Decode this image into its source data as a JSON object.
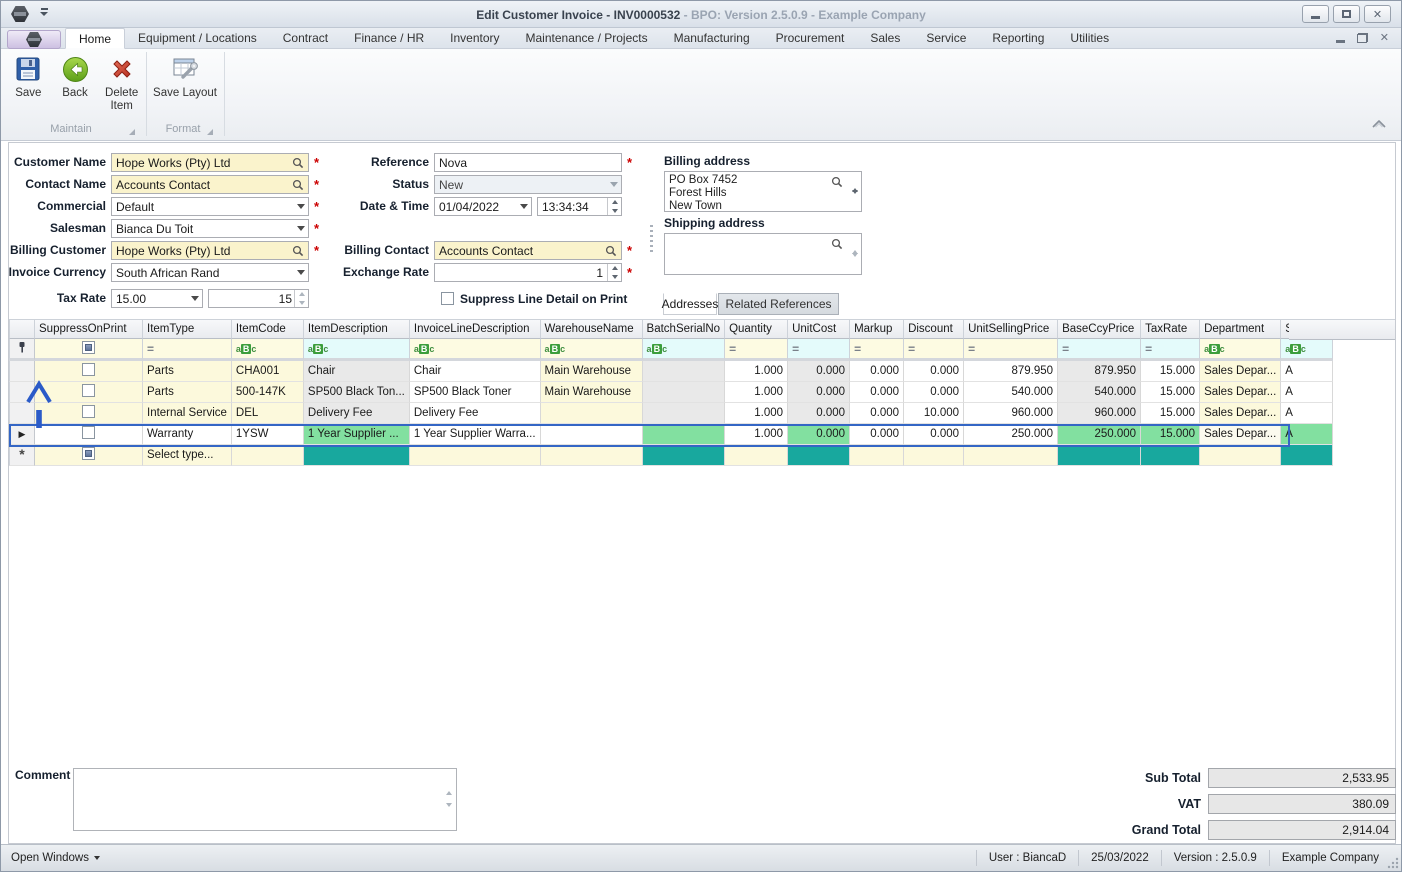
{
  "window": {
    "title": "Edit Customer Invoice - INV0000532",
    "title_suffix": " - BPO: Version 2.5.0.9 - Example Company"
  },
  "ribbon": {
    "tabs": [
      "Home",
      "Equipment / Locations",
      "Contract",
      "Finance / HR",
      "Inventory",
      "Maintenance / Projects",
      "Manufacturing",
      "Procurement",
      "Sales",
      "Service",
      "Reporting",
      "Utilities"
    ],
    "active_tab": "Home",
    "buttons": {
      "save": "Save",
      "back": "Back",
      "delete_item": "Delete\nItem",
      "save_layout": "Save Layout"
    },
    "groups": {
      "maintain": "Maintain",
      "format": "Format"
    }
  },
  "form": {
    "customer_name": {
      "label": "Customer Name",
      "value": "Hope Works (Pty) Ltd"
    },
    "contact_name": {
      "label": "Contact Name",
      "value": "Accounts Contact"
    },
    "commercial": {
      "label": "Commercial",
      "value": "Default"
    },
    "salesman": {
      "label": "Salesman",
      "value": "Bianca Du Toit"
    },
    "billing_customer": {
      "label": "Billing Customer",
      "value": "Hope Works (Pty) Ltd"
    },
    "invoice_currency": {
      "label": "Invoice Currency",
      "value": "South African Rand"
    },
    "tax_rate": {
      "label": "Tax Rate",
      "value": "15.00",
      "amount": "15"
    },
    "reference": {
      "label": "Reference",
      "value": "Nova"
    },
    "status": {
      "label": "Status",
      "value": "New"
    },
    "date_time": {
      "label": "Date & Time",
      "date": "01/04/2022",
      "time": "13:34:34"
    },
    "billing_contact": {
      "label": "Billing Contact",
      "value": "Accounts Contact"
    },
    "exchange_rate": {
      "label": "Exchange Rate",
      "value": "1"
    },
    "suppress_line_detail": {
      "label": "Suppress Line Detail on Print",
      "checked": false
    }
  },
  "addresses": {
    "billing_label": "Billing address",
    "billing_lines": [
      "PO Box 7452",
      "Forest Hills",
      "New Town"
    ],
    "shipping_label": "Shipping address",
    "shipping_lines": [],
    "tabs": [
      "Addresses",
      "Related References"
    ],
    "active_tab": "Addresses"
  },
  "grid": {
    "columns": [
      "SuppressOnPrint",
      "ItemType",
      "ItemCode",
      "ItemDescription",
      "InvoiceLineDescription",
      "WarehouseName",
      "BatchSerialNo",
      "Quantity",
      "UnitCost",
      "Markup",
      "Discount",
      "UnitSellingPrice",
      "BaseCcyPrice",
      "TaxRate",
      "Department",
      "Status"
    ],
    "filter_types": [
      "checkbox",
      "equals",
      "text",
      "text",
      "text",
      "text",
      "text",
      "equals",
      "equals",
      "equals",
      "equals",
      "equals",
      "equals",
      "equals",
      "text",
      "text"
    ],
    "rows": [
      {
        "suppress_on_print": false,
        "type": "Parts",
        "code": "CHA001",
        "desc": "Chair",
        "line_desc": "Chair",
        "warehouse": "Main Warehouse",
        "batch": "",
        "qty": "1.000",
        "unit_cost": "0.000",
        "markup": "0.000",
        "discount": "0.000",
        "unit_selling": "879.950",
        "base_ccy": "879.950",
        "tax": "15.000",
        "dept": "Sales Depar...",
        "status": "A"
      },
      {
        "suppress_on_print": false,
        "type": "Parts",
        "code": "500-147K",
        "desc": "SP500 Black Ton...",
        "line_desc": "SP500 Black Toner",
        "warehouse": "Main Warehouse",
        "batch": "",
        "qty": "1.000",
        "unit_cost": "0.000",
        "markup": "0.000",
        "discount": "0.000",
        "unit_selling": "540.000",
        "base_ccy": "540.000",
        "tax": "15.000",
        "dept": "Sales Depar...",
        "status": "A"
      },
      {
        "suppress_on_print": false,
        "type": "Internal Service",
        "code": "DEL",
        "desc": "Delivery Fee",
        "line_desc": "Delivery Fee",
        "warehouse": "",
        "batch": "",
        "qty": "1.000",
        "unit_cost": "0.000",
        "markup": "0.000",
        "discount": "10.000",
        "unit_selling": "960.000",
        "base_ccy": "960.000",
        "tax": "15.000",
        "dept": "Sales Depar...",
        "status": "A"
      },
      {
        "suppress_on_print": false,
        "selected": true,
        "type": "Warranty",
        "code": "1YSW",
        "desc": "1 Year Supplier ...",
        "line_desc": "1 Year Supplier Warra...",
        "warehouse": "",
        "batch": "",
        "qty": "1.000",
        "unit_cost": "0.000",
        "markup": "0.000",
        "discount": "0.000",
        "unit_selling": "250.000",
        "base_ccy": "250.000",
        "tax": "15.000",
        "dept": "Sales Depar...",
        "status": "A"
      }
    ],
    "new_row": {
      "suppress_on_print": true,
      "type": "Select type...",
      "code": "",
      "desc": "",
      "line_desc": "",
      "warehouse": "",
      "batch": "",
      "qty": "",
      "unit_cost": "",
      "markup": "",
      "discount": "",
      "unit_selling": "",
      "base_ccy": "",
      "tax": "",
      "dept": "",
      "status": ""
    }
  },
  "totals": {
    "sub_total_label": "Sub Total",
    "sub_total": "2,533.95",
    "vat_label": "VAT",
    "vat": "380.09",
    "grand_total_label": "Grand Total",
    "grand_total": "2,914.04"
  },
  "comment": {
    "label": "Comment",
    "value": ""
  },
  "statusbar": {
    "open_windows": "Open Windows",
    "user": "User : BiancaD",
    "date": "25/03/2022",
    "version": "Version : 2.5.0.9",
    "company": "Example Company"
  },
  "colors": {
    "field_yellow": "#FAF3CC",
    "grid_yellow": "#FCF9DC",
    "filter_cyan": "#E4FBFB",
    "readonly_gray": "#E9E9E9",
    "highlight_green": "#82E0A0",
    "new_row_teal": "#18A89E",
    "selection_blue": "#3466C5",
    "required_red": "#CC0000"
  }
}
